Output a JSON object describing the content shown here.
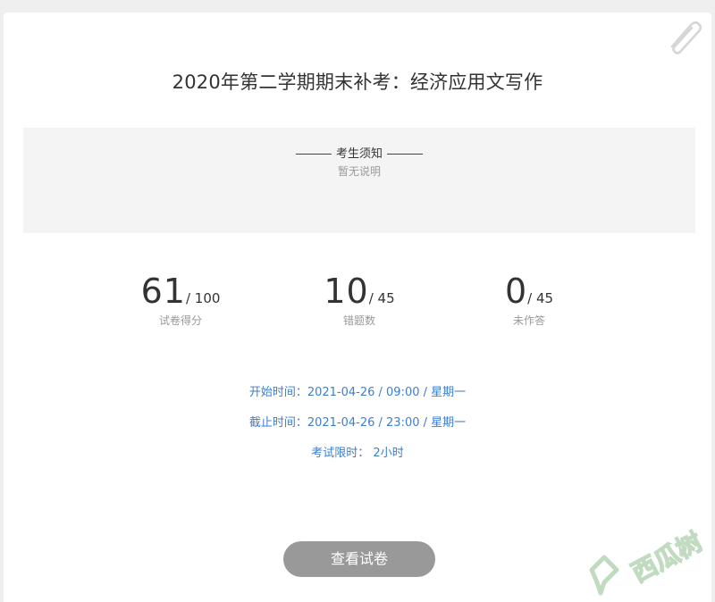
{
  "exam": {
    "title": "2020年第二学期期末补考：经济应用文写作"
  },
  "notice": {
    "heading": "考生须知",
    "body": "暂无说明"
  },
  "stats": {
    "score": {
      "value": "61",
      "total": "/ 100",
      "label": "试卷得分"
    },
    "wrong": {
      "value": "10",
      "total": "/ 45",
      "label": "错题数"
    },
    "unanswered": {
      "value": "0",
      "total": "/ 45",
      "label": "未作答"
    }
  },
  "times": {
    "start": "开始时间：2021-04-26 / 09:00 / 星期一",
    "end": "截止时间：2021-04-26 / 23:00 / 星期一",
    "limit": "考试限时： 2小时"
  },
  "actions": {
    "view_paper": "查看试卷"
  },
  "watermark": {
    "text": "西瓜树"
  },
  "colors": {
    "accent": "#3c7ed1",
    "button": "#999999",
    "notice_bg": "#f4f4f4"
  }
}
